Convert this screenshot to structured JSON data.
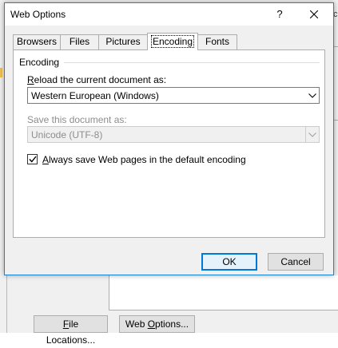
{
  "background": {
    "partial_text": "ce",
    "file_locations_button": {
      "mnemonic": "F",
      "rest": "ile Locations..."
    },
    "web_options_button": {
      "mnemonic": "",
      "pre": "Web ",
      "mn": "O",
      "rest": "ptions..."
    }
  },
  "dialog": {
    "title": "Web Options",
    "help_label": "?",
    "tabs": [
      {
        "label": "Browsers",
        "active": false
      },
      {
        "label": "Files",
        "active": false
      },
      {
        "label": "Pictures",
        "active": false
      },
      {
        "label": "Encoding",
        "active": true
      },
      {
        "label": "Fonts",
        "active": false
      }
    ],
    "encoding": {
      "group_title": "Encoding",
      "reload_label": {
        "mnemonic": "R",
        "rest": "eload the current document as:"
      },
      "reload_value": "Western European (Windows)",
      "save_label": "Save this document as:",
      "save_value": "Unicode (UTF-8)",
      "always_save": {
        "checked": true,
        "mnemonic": "A",
        "rest": "lways save Web pages in the default encoding"
      }
    },
    "ok_label": "OK",
    "cancel_label": "Cancel"
  },
  "colors": {
    "accent": "#0078d7",
    "window_border": "#1883d7",
    "disabled_text": "#8d8d8d"
  }
}
